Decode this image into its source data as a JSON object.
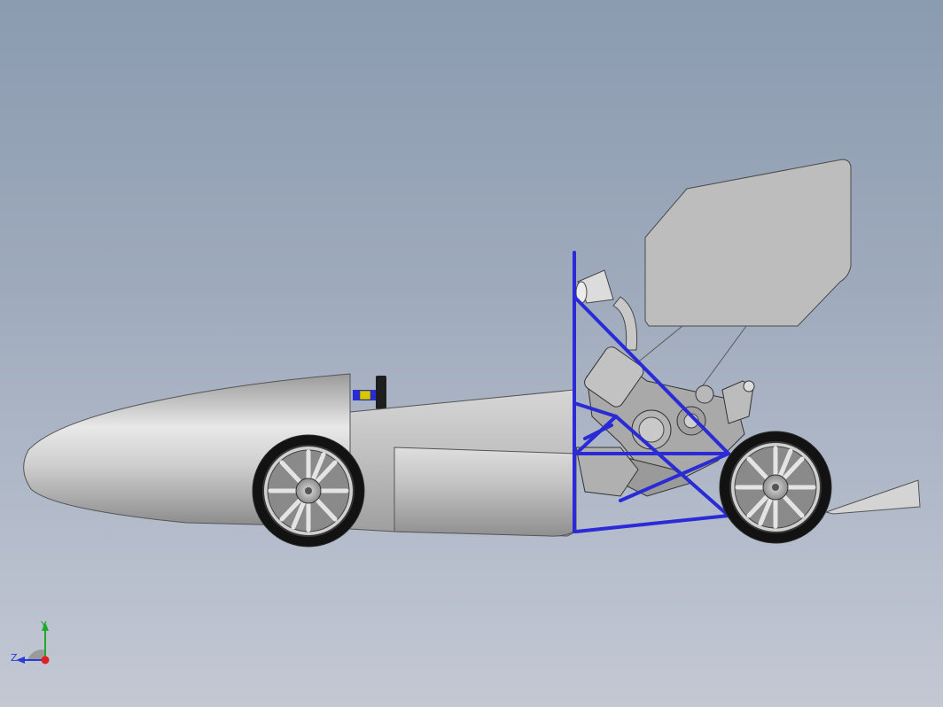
{
  "viewport": {
    "background_top": "#8b9bb0",
    "background_bottom": "#c3c8d3"
  },
  "model": {
    "frame_color": "#2a2ad6",
    "body_color": "#c8c8c8",
    "wing_color": "#bdbdbd"
  },
  "triad": {
    "y_label": "Y",
    "z_label": "Z",
    "y_color": "#1faa2a",
    "z_color": "#2b3bd8",
    "origin_color": "#e02020"
  }
}
